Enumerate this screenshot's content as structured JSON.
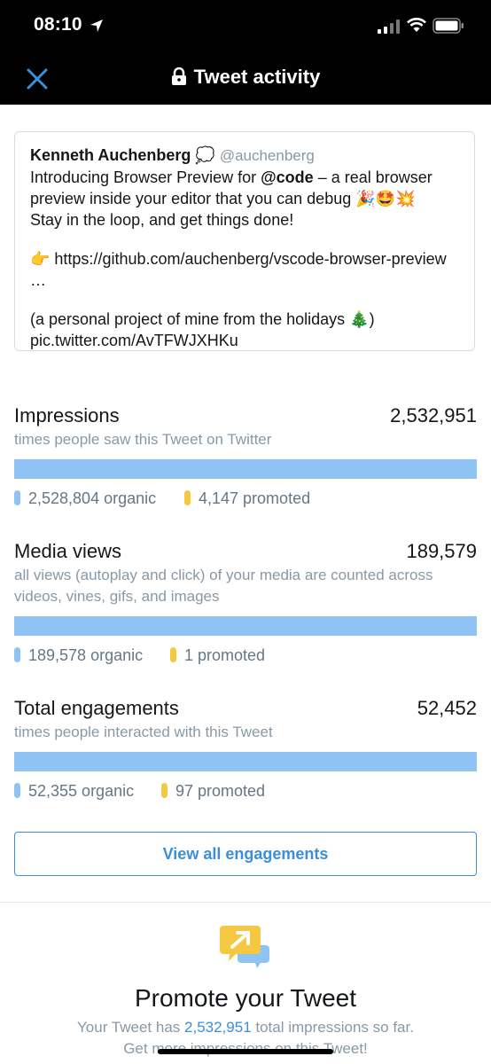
{
  "status_bar": {
    "time": "08:10"
  },
  "nav": {
    "title": "Tweet activity"
  },
  "tweet": {
    "author": "Kenneth Auchenberg",
    "author_emoji": "💭",
    "handle": "@auchenberg",
    "line1_prefix": "Introducing Browser Preview for ",
    "mention": "@code",
    "line1_suffix": " – a real browser preview inside your editor that you can debug 🎉🤩💥",
    "line2": "Stay in the loop, and get things done!",
    "link": "👉 https://github.com/auchenberg/vscode-browser-preview …",
    "line3": "(a personal project of mine from the holidays 🎄)",
    "pic": "pic.twitter.com/AvTFWJXHKu"
  },
  "metrics": {
    "impressions": {
      "label": "Impressions",
      "value": "2,532,951",
      "sub": "times people saw this Tweet on Twitter",
      "organic": "2,528,804 organic",
      "promoted": "4,147 promoted",
      "organic_fraction": 0.9984
    },
    "media_views": {
      "label": "Media views",
      "value": "189,579",
      "sub": "all views (autoplay and click) of your media are counted across videos, vines, gifs, and images",
      "organic": "189,578 organic",
      "promoted": "1 promoted",
      "organic_fraction": 0.99999
    },
    "engagements": {
      "label": "Total engagements",
      "value": "52,452",
      "sub": "times people interacted with this Tweet",
      "organic": "52,355 organic",
      "promoted": "97 promoted",
      "organic_fraction": 0.9982
    }
  },
  "view_all_label": "View all engagements",
  "promote": {
    "title": "Promote your Tweet",
    "text_prefix": "Your Tweet has ",
    "impressions_link": "2,532,951",
    "text_suffix": " total impressions so far.",
    "line2": "Get more impressions on this Tweet!"
  },
  "colors": {
    "accent": "#3b8fd9",
    "organic": "#8ec3f4",
    "promoted": "#f5c842",
    "header_bg": "#000000"
  },
  "icons": {
    "close": "close-icon",
    "lock": "lock-icon",
    "promote": "promote-icon"
  }
}
